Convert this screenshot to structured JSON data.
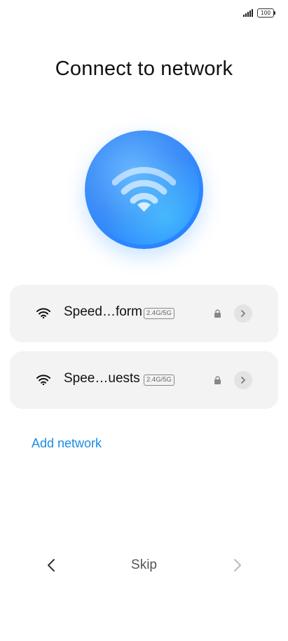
{
  "status_bar": {
    "battery_level": "100",
    "icons": [
      "signal-icon",
      "battery-icon"
    ]
  },
  "title": "Connect to network",
  "hero": {
    "icon": "wifi-icon",
    "colors": {
      "center": "#67b6ff",
      "edge": "#1e7cf7"
    }
  },
  "networks": [
    {
      "name": "Speed…form",
      "band": "2.4G/5G",
      "secured": true,
      "icons": [
        "wifi-icon",
        "lock-icon",
        "chevron-right-icon"
      ]
    },
    {
      "name": "Spee…uests",
      "band": "2.4G/5G",
      "secured": true,
      "icons": [
        "wifi-icon",
        "lock-icon",
        "chevron-right-icon"
      ]
    }
  ],
  "add_network": "Add network",
  "nav": {
    "back_icon": "chevron-left-icon",
    "skip": "Skip",
    "next_icon": "chevron-right-icon"
  },
  "colors": {
    "accent": "#1a8ce6",
    "card_bg": "#f3f3f3"
  }
}
